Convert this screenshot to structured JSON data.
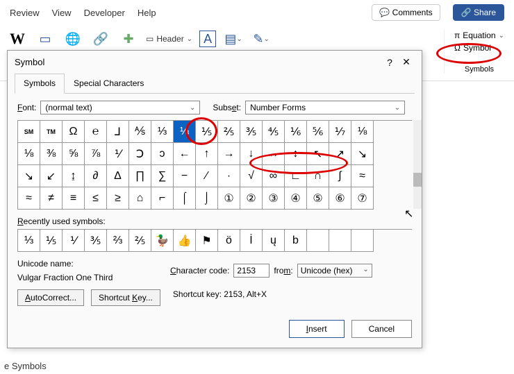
{
  "ribbon": {
    "tabs": [
      "Review",
      "View",
      "Developer",
      "Help"
    ],
    "comments": "Comments",
    "share": "Share",
    "header_label": "Header",
    "equation_label": "Equation",
    "symbol_label": "Symbol",
    "symbols_group": "Symbols"
  },
  "dialog": {
    "title": "Symbol",
    "tabs": {
      "symbols": "Symbols",
      "special": "Special Characters"
    },
    "font_label": "Font:",
    "font_value": "(normal text)",
    "subset_label": "Subset:",
    "subset_value": "Number Forms",
    "grid": [
      [
        "SM",
        "TM",
        "Ω",
        "℮",
        "⅃",
        "⅍",
        "⅓",
        "⅓",
        "⅕",
        "⅖",
        "⅗",
        "⅘",
        "⅙",
        "⅚",
        "⅐",
        "⅛"
      ],
      [
        "⅛",
        "⅜",
        "⅝",
        "⅞",
        "⅟",
        "Ↄ",
        "ↄ",
        "←",
        "↑",
        "→",
        "↓",
        "↔",
        "↕",
        "↖",
        "↗",
        "↘"
      ],
      [
        "↘",
        "↙",
        "↨",
        "∂",
        "Δ",
        "∏",
        "∑",
        "−",
        "∕",
        "∙",
        "√",
        "∞",
        "∟",
        "∩",
        "∫",
        "≈"
      ],
      [
        "≈",
        "≠",
        "≡",
        "≤",
        "≥",
        "⌂",
        "⌐",
        "⌠",
        "⌡",
        "①",
        "②",
        "③",
        "④",
        "⑤",
        "⑥",
        "⑦"
      ]
    ],
    "selected_index": [
      0,
      7
    ],
    "recent_label": "Recently used symbols:",
    "recent": [
      "⅓",
      "⅕",
      "⅟",
      "⅗",
      "⅔",
      "⅖",
      "🦆",
      "👍",
      "⚑",
      "ö",
      "İ",
      "ų",
      "b",
      "",
      "",
      ""
    ],
    "unicode_name_label": "Unicode name:",
    "unicode_name": "Vulgar Fraction One Third",
    "charcode_label": "Character code:",
    "charcode_value": "2153",
    "from_label": "from:",
    "from_value": "Unicode (hex)",
    "autocorrect": "AutoCorrect...",
    "shortcut_key_btn": "Shortcut Key...",
    "shortcut_text": "Shortcut key: 2153, Alt+X",
    "insert": "Insert",
    "cancel": "Cancel"
  },
  "partial_text": "e Symbols"
}
